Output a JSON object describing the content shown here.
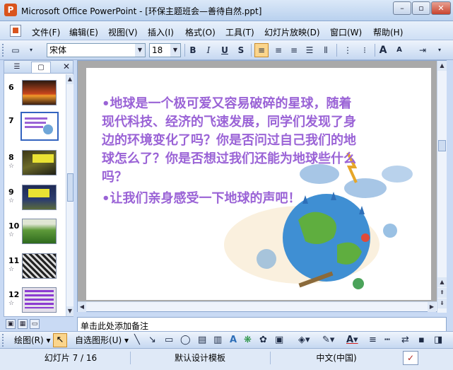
{
  "window": {
    "title": "Microsoft Office PowerPoint - [环保主题班会—善待自然.ppt]",
    "app_icon": "powerpoint-icon",
    "controls": [
      "minimize",
      "restore",
      "close"
    ]
  },
  "menu": {
    "items": [
      "文件(F)",
      "编辑(E)",
      "视图(V)",
      "插入(I)",
      "格式(O)",
      "工具(T)",
      "幻灯片放映(D)",
      "窗口(W)",
      "帮助(H)"
    ]
  },
  "toolbar": {
    "font_name": "宋体",
    "font_size": "18",
    "bold": "B",
    "italic": "I",
    "underline": "U",
    "shadow": "S",
    "font_grow": "A",
    "font_shrink": "A",
    "align_left_active": true
  },
  "slides_pane": {
    "thumbnails": [
      {
        "number": "6",
        "selected": false
      },
      {
        "number": "7",
        "selected": true
      },
      {
        "number": "8",
        "selected": false
      },
      {
        "number": "9",
        "selected": false
      },
      {
        "number": "10",
        "selected": false
      },
      {
        "number": "11",
        "selected": false
      },
      {
        "number": "12",
        "selected": false
      }
    ]
  },
  "slide": {
    "paragraph1": "•地球是一个极可爱又容易破碎的星球，随着现代科技、经济的飞速发展，同学们发现了身边的环境变化了吗？你是否问过自己我们的地球怎么了？你是否想过我们还能为地球些什么吗？",
    "paragraph2": "•让我们亲身感受一下地球的声吧！",
    "text_color": "#9a63d6"
  },
  "notes": {
    "placeholder": "单击此处添加备注"
  },
  "drawing_toolbar": {
    "draw_label": "绘图(R)",
    "autoshape_label": "自选图形(U)"
  },
  "status": {
    "slide_position": "幻灯片 7 / 16",
    "design_template": "默认设计模板",
    "language": "中文(中国)"
  }
}
